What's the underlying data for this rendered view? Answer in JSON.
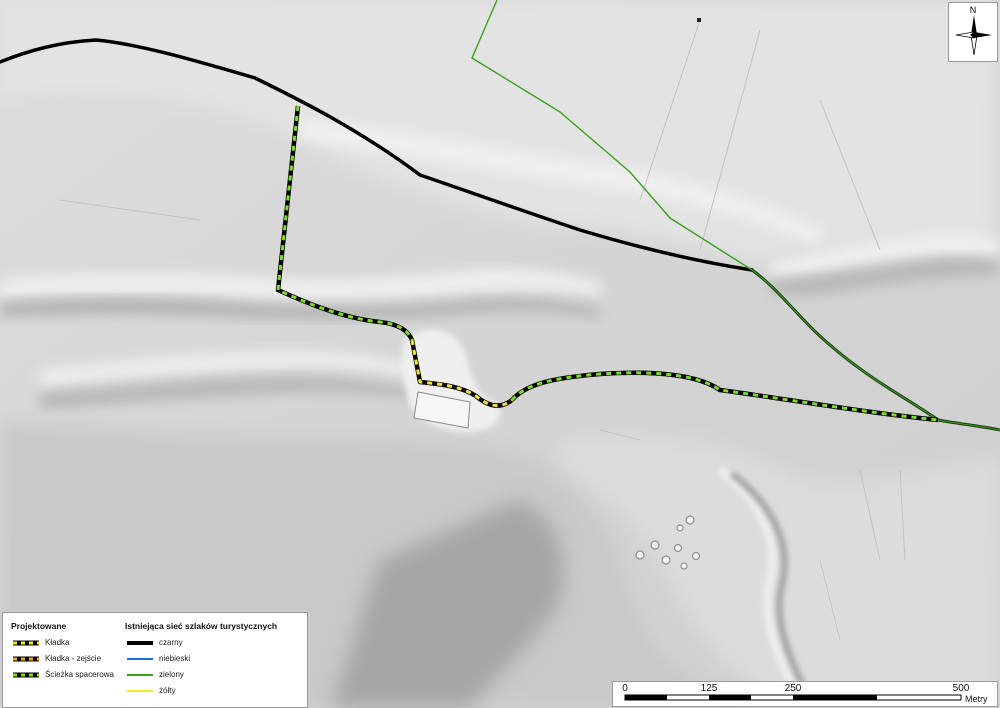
{
  "map": {
    "north_label": "N",
    "north_icon": "compass-rose-icon"
  },
  "legend": {
    "projected_heading": "Projektowane",
    "existing_heading": "Istniejąca sieć szlaków turystycznych",
    "projected_items": [
      {
        "label": "Kładka",
        "symbol": "dashed-black-yellow",
        "color_a": "#000000",
        "color_b": "#f2e33a"
      },
      {
        "label": "Kładka - zejście",
        "symbol": "dashed-black-orange",
        "color_a": "#000000",
        "color_b": "#f0a030"
      },
      {
        "label": "Ścieżka spacerowa",
        "symbol": "dashed-black-green",
        "color_a": "#000000",
        "color_b": "#7cdc2a"
      }
    ],
    "existing_items": [
      {
        "label": "czarny",
        "color": "#000000"
      },
      {
        "label": "niebieski",
        "color": "#1f6fd0"
      },
      {
        "label": "zielony",
        "color": "#3aa11c"
      },
      {
        "label": "żółty",
        "color": "#f3ea2e"
      }
    ]
  },
  "scale": {
    "ticks": [
      "0",
      "125",
      "250",
      "500"
    ],
    "unit": "Metry"
  },
  "colors": {
    "terrain_light": "#e4e4e4",
    "terrain_mid": "#cccccc",
    "terrain_dark": "#a9a9a9",
    "trail_black": "#000000",
    "trail_green": "#3aa11c",
    "walk_green": "#7cdc2a",
    "footbridge_yellow": "#f2e33a"
  }
}
